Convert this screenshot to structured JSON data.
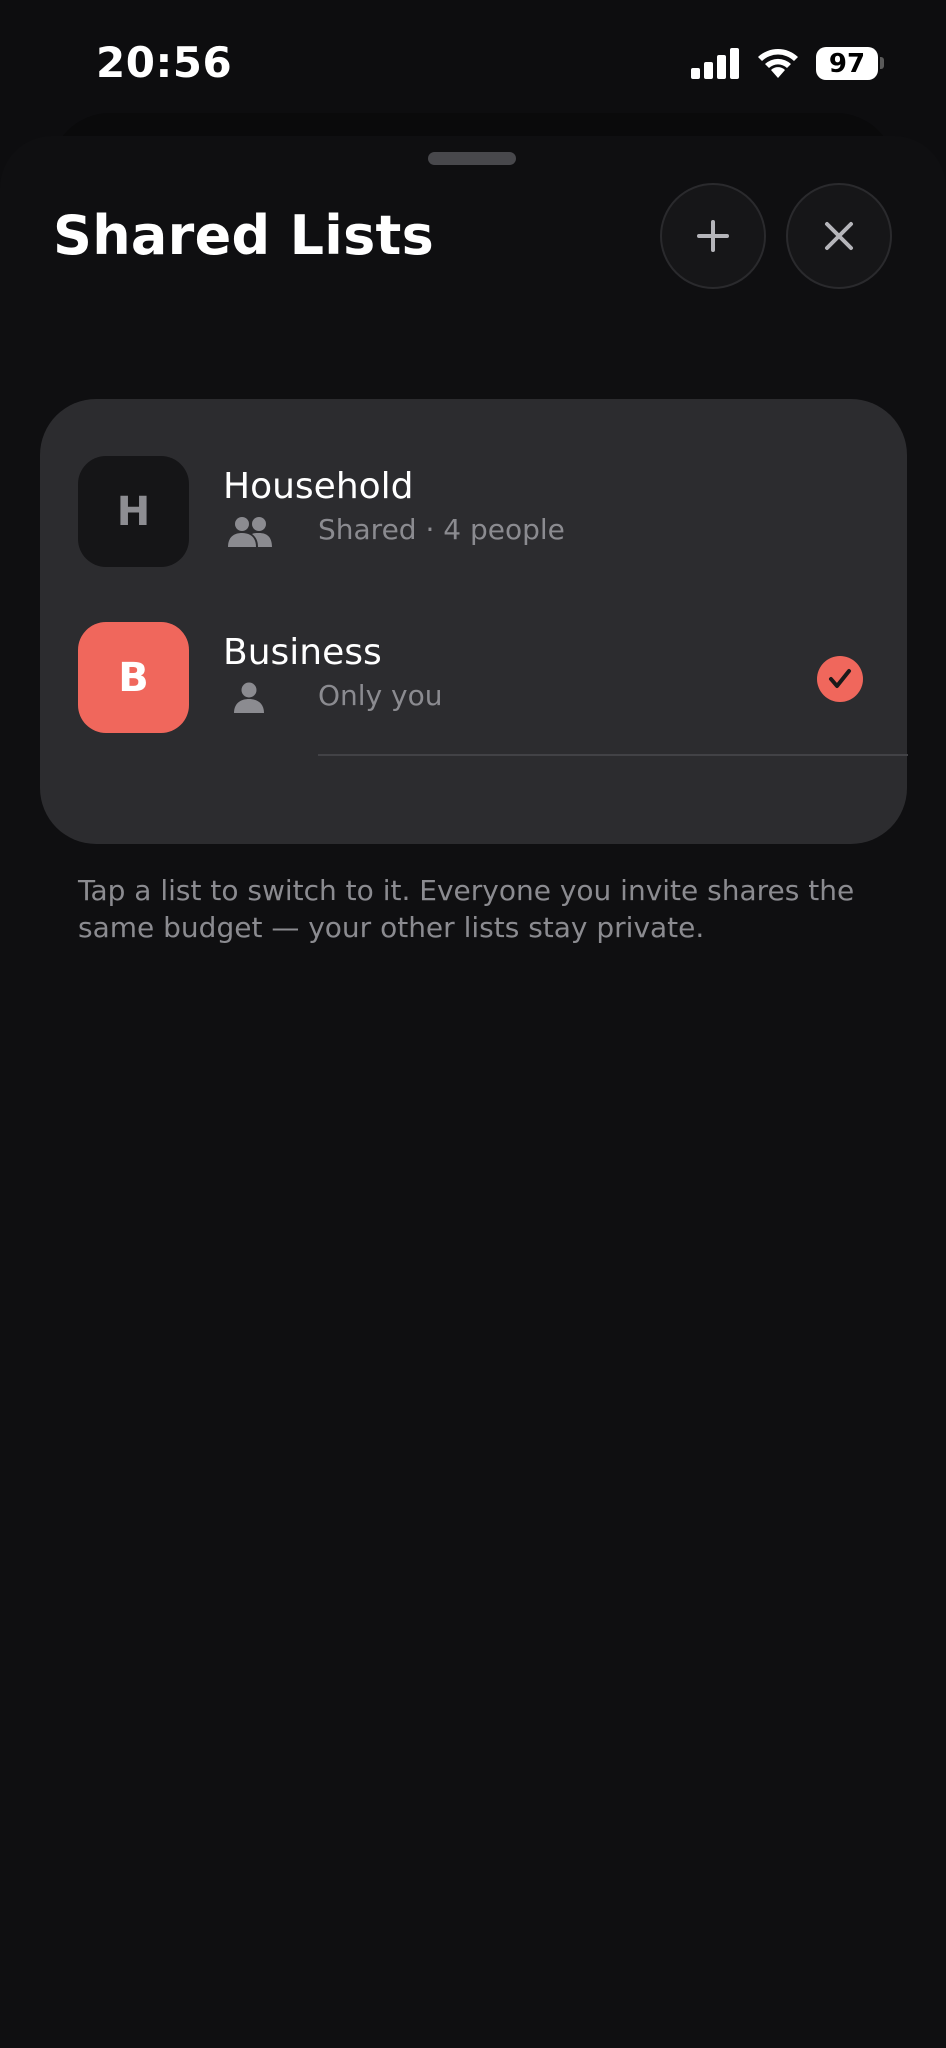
{
  "status_bar": {
    "time": "20:56",
    "battery": "97"
  },
  "sheet": {
    "title": "Shared Lists",
    "add_button_icon": "plus-icon",
    "close_button_icon": "close-icon"
  },
  "lists": [
    {
      "initial": "H",
      "name": "Household",
      "subtitle": "Shared · 4 people",
      "icon": "people-icon",
      "avatar_color": "#151517",
      "selected": false
    },
    {
      "initial": "B",
      "name": "Business",
      "subtitle": "Only you",
      "icon": "person-icon",
      "avatar_color": "#f0675c",
      "selected": true
    }
  ],
  "footnote": "Tap a list to switch to it. Everyone you invite shares the same budget — your other lists stay private.",
  "colors": {
    "accent": "#f0675c",
    "background": "#0f0f11",
    "card": "#2c2c2f",
    "secondary_text": "#8b8b90"
  }
}
